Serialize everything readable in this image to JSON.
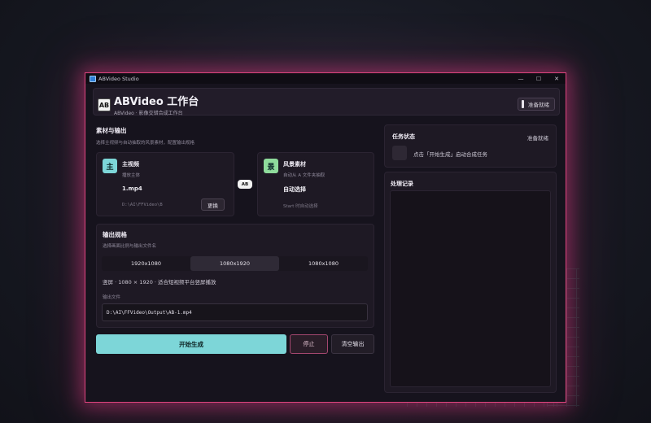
{
  "window": {
    "title": "ABVideo Studio",
    "controls": [
      "—",
      "☐",
      "✕"
    ]
  },
  "header": {
    "logo_text": "AB",
    "title": "ABVideo 工作台",
    "subtitle": "ABVideo · 影像交错合成工作台",
    "status": "准备就绪"
  },
  "materials": {
    "title": "素材与输出",
    "desc": "选择主视频与自动抽取的风景素材，配置输出规格",
    "ab_label": "AB",
    "main_video": {
      "badge": "主",
      "title": "主视频",
      "sub": "播放主体",
      "value": "1.mp4",
      "path": "D:\\AI\\FFVideo\\B",
      "button": "更换"
    },
    "scenery": {
      "badge": "景",
      "title": "风景素材",
      "sub": "自动从 A 文件夹抽取",
      "value": "自动选择",
      "hint": "Start 时自动选择"
    }
  },
  "output": {
    "title": "输出规格",
    "desc": "选择画面比例与输出文件名",
    "options": [
      "1920x1080",
      "1080x1920",
      "1080x1080"
    ],
    "selected": "1080x1920",
    "spec_text": "竖屏 · 1080 × 1920 · 适合短视频平台竖屏播放",
    "file_label": "输出文件",
    "file_value": "D:\\AI\\FFVideo\\Output\\AB-1.mp4"
  },
  "actions": {
    "start": "开始生成",
    "stop": "停止",
    "clear": "清空输出"
  },
  "task": {
    "title": "任务状态",
    "status": "准备就绪",
    "message": "点击「开始生成」启动合成任务"
  },
  "log": {
    "title": "处理记录"
  },
  "colors": {
    "accent": "#7dd6d8",
    "scenery_badge": "#8fdc9c",
    "window_border": "#e0457f",
    "stop_border": "#a4476f"
  }
}
